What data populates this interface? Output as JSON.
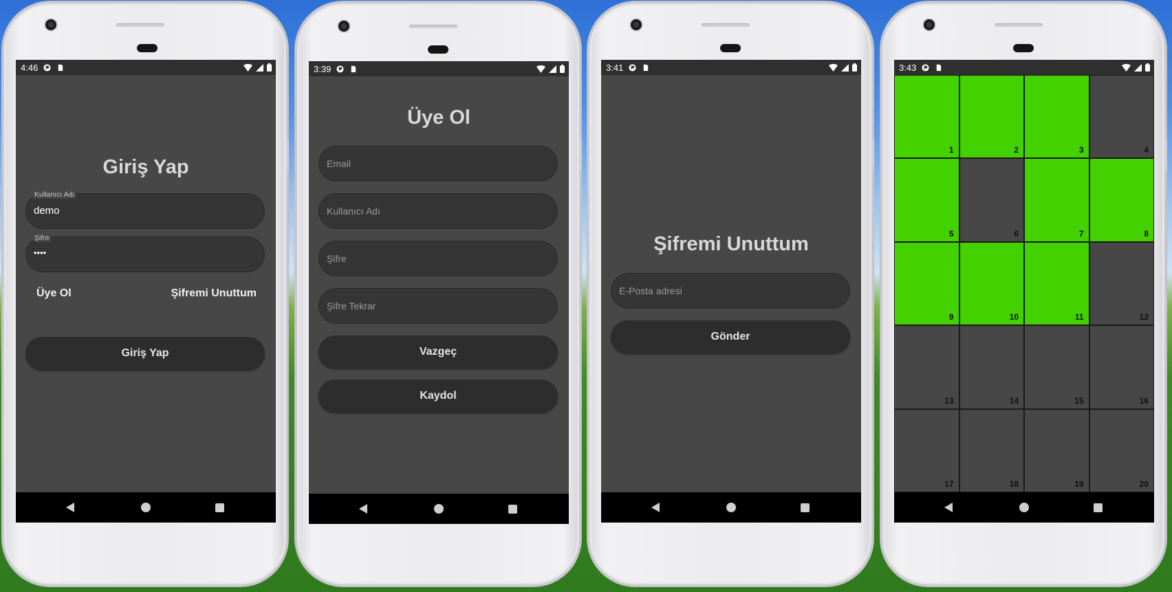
{
  "phones": [
    {
      "status": {
        "time": "4:46"
      },
      "title": "Giriş Yap",
      "username_field": {
        "label": "Kullanıcı Adı",
        "value": "demo"
      },
      "password_field": {
        "label": "Şifre",
        "value": "••••"
      },
      "links": {
        "signup": "Üye Ol",
        "forgot": "Şifremi Unuttum"
      },
      "login_button": "Giriş Yap"
    },
    {
      "status": {
        "time": "3:39"
      },
      "title": "Üye Ol",
      "fields": [
        {
          "placeholder": "Email"
        },
        {
          "placeholder": "Kullanıcı Adı"
        },
        {
          "placeholder": "Şifre"
        },
        {
          "placeholder": "Şifre Tekrar"
        }
      ],
      "buttons": {
        "cancel": "Vazgeç",
        "register": "Kaydol"
      }
    },
    {
      "status": {
        "time": "3:41"
      },
      "title": "Şifremi Unuttum",
      "email_field": {
        "placeholder": "E-Posta adresi"
      },
      "send_button": "Gönder"
    },
    {
      "status": {
        "time": "3:43"
      },
      "grid": {
        "columns": 4,
        "cells": [
          {
            "label": "1",
            "active": true
          },
          {
            "label": "2",
            "active": true
          },
          {
            "label": "3",
            "active": true
          },
          {
            "label": "4",
            "active": false
          },
          {
            "label": "5",
            "active": true
          },
          {
            "label": "6",
            "active": false
          },
          {
            "label": "7",
            "active": true
          },
          {
            "label": "8",
            "active": true
          },
          {
            "label": "9",
            "active": true
          },
          {
            "label": "10",
            "active": true
          },
          {
            "label": "11",
            "active": true
          },
          {
            "label": "12",
            "active": false
          },
          {
            "label": "13",
            "active": false
          },
          {
            "label": "14",
            "active": false
          },
          {
            "label": "15",
            "active": false
          },
          {
            "label": "16",
            "active": false
          },
          {
            "label": "17",
            "active": false
          },
          {
            "label": "18",
            "active": false
          },
          {
            "label": "19",
            "active": false
          },
          {
            "label": "20",
            "active": false
          }
        ],
        "active_color": "#43d100",
        "inactive_color": "#474747"
      }
    }
  ],
  "icons": {
    "status_left": [
      "app-icon",
      "sd-card-icon"
    ],
    "status_right": [
      "wifi-icon",
      "signal-icon",
      "battery-icon"
    ],
    "nav": [
      "back-icon",
      "home-icon",
      "recents-icon"
    ]
  }
}
